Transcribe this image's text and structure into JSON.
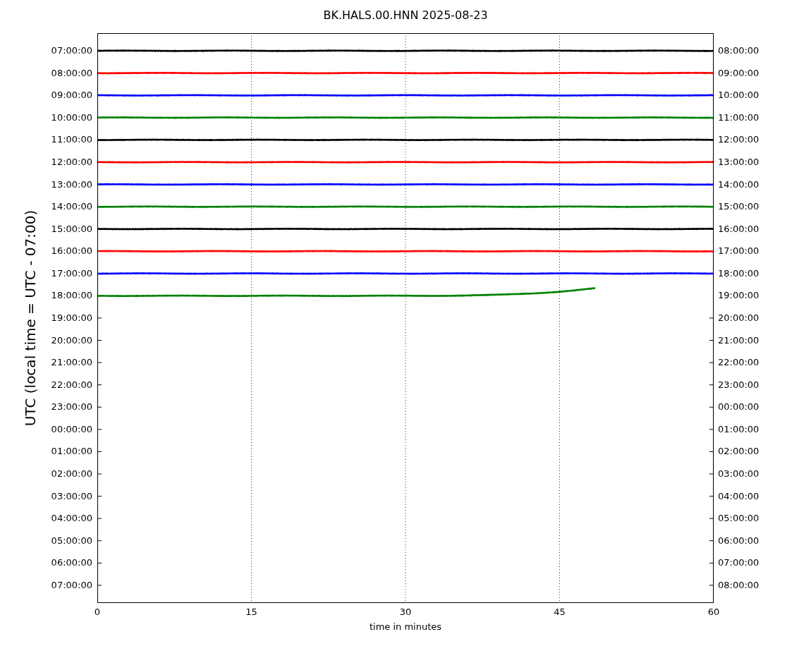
{
  "title": "BK.HALS.00.HNN 2025-08-23",
  "ylabel": "UTC (local time = UTC - 07:00)",
  "xlabel": "time in minutes",
  "xticks": [
    "0",
    "15",
    "30",
    "45",
    "60"
  ],
  "left_ticks": [
    "07:00:00",
    "08:00:00",
    "09:00:00",
    "10:00:00",
    "11:00:00",
    "12:00:00",
    "13:00:00",
    "14:00:00",
    "15:00:00",
    "16:00:00",
    "17:00:00",
    "18:00:00",
    "19:00:00",
    "20:00:00",
    "21:00:00",
    "22:00:00",
    "23:00:00",
    "00:00:00",
    "01:00:00",
    "02:00:00",
    "03:00:00",
    "04:00:00",
    "05:00:00",
    "06:00:00",
    "07:00:00"
  ],
  "right_ticks": [
    "08:00:00",
    "09:00:00",
    "10:00:00",
    "11:00:00",
    "12:00:00",
    "13:00:00",
    "14:00:00",
    "15:00:00",
    "16:00:00",
    "17:00:00",
    "18:00:00",
    "19:00:00",
    "20:00:00",
    "21:00:00",
    "22:00:00",
    "23:00:00",
    "00:00:00",
    "01:00:00",
    "02:00:00",
    "03:00:00",
    "04:00:00",
    "05:00:00",
    "06:00:00",
    "07:00:00",
    "08:00:00"
  ],
  "traces": [
    {
      "color": "#000000",
      "level": 1
    },
    {
      "color": "#ff0000",
      "level": 1
    },
    {
      "color": "#0000ff",
      "level": 1
    },
    {
      "color": "#008000",
      "level": 1
    },
    {
      "color": "#000000",
      "level": 1
    },
    {
      "color": "#ff0000",
      "level": 1
    },
    {
      "color": "#0000ff",
      "level": 1
    },
    {
      "color": "#008000",
      "level": 1
    },
    {
      "color": "#000000",
      "level": 1
    },
    {
      "color": "#ff0000",
      "level": 1
    },
    {
      "color": "#0000ff",
      "level": 1
    },
    {
      "color": "#008000",
      "level": 0.81
    }
  ]
}
